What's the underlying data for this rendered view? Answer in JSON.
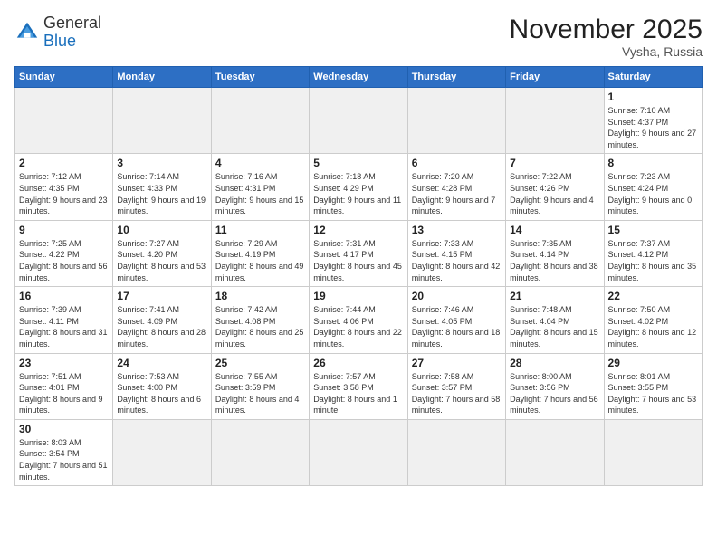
{
  "logo": {
    "text_general": "General",
    "text_blue": "Blue"
  },
  "title": {
    "month_year": "November 2025",
    "location": "Vysha, Russia"
  },
  "weekdays": [
    "Sunday",
    "Monday",
    "Tuesday",
    "Wednesday",
    "Thursday",
    "Friday",
    "Saturday"
  ],
  "weeks": [
    [
      {
        "day": "",
        "empty": true
      },
      {
        "day": "",
        "empty": true
      },
      {
        "day": "",
        "empty": true
      },
      {
        "day": "",
        "empty": true
      },
      {
        "day": "",
        "empty": true
      },
      {
        "day": "",
        "empty": true
      },
      {
        "day": "1",
        "sunrise": "7:10 AM",
        "sunset": "4:37 PM",
        "daylight": "9 hours and 27 minutes."
      }
    ],
    [
      {
        "day": "2",
        "sunrise": "7:12 AM",
        "sunset": "4:35 PM",
        "daylight": "9 hours and 23 minutes."
      },
      {
        "day": "3",
        "sunrise": "7:14 AM",
        "sunset": "4:33 PM",
        "daylight": "9 hours and 19 minutes."
      },
      {
        "day": "4",
        "sunrise": "7:16 AM",
        "sunset": "4:31 PM",
        "daylight": "9 hours and 15 minutes."
      },
      {
        "day": "5",
        "sunrise": "7:18 AM",
        "sunset": "4:29 PM",
        "daylight": "9 hours and 11 minutes."
      },
      {
        "day": "6",
        "sunrise": "7:20 AM",
        "sunset": "4:28 PM",
        "daylight": "9 hours and 7 minutes."
      },
      {
        "day": "7",
        "sunrise": "7:22 AM",
        "sunset": "4:26 PM",
        "daylight": "9 hours and 4 minutes."
      },
      {
        "day": "8",
        "sunrise": "7:23 AM",
        "sunset": "4:24 PM",
        "daylight": "9 hours and 0 minutes."
      }
    ],
    [
      {
        "day": "9",
        "sunrise": "7:25 AM",
        "sunset": "4:22 PM",
        "daylight": "8 hours and 56 minutes."
      },
      {
        "day": "10",
        "sunrise": "7:27 AM",
        "sunset": "4:20 PM",
        "daylight": "8 hours and 53 minutes."
      },
      {
        "day": "11",
        "sunrise": "7:29 AM",
        "sunset": "4:19 PM",
        "daylight": "8 hours and 49 minutes."
      },
      {
        "day": "12",
        "sunrise": "7:31 AM",
        "sunset": "4:17 PM",
        "daylight": "8 hours and 45 minutes."
      },
      {
        "day": "13",
        "sunrise": "7:33 AM",
        "sunset": "4:15 PM",
        "daylight": "8 hours and 42 minutes."
      },
      {
        "day": "14",
        "sunrise": "7:35 AM",
        "sunset": "4:14 PM",
        "daylight": "8 hours and 38 minutes."
      },
      {
        "day": "15",
        "sunrise": "7:37 AM",
        "sunset": "4:12 PM",
        "daylight": "8 hours and 35 minutes."
      }
    ],
    [
      {
        "day": "16",
        "sunrise": "7:39 AM",
        "sunset": "4:11 PM",
        "daylight": "8 hours and 31 minutes."
      },
      {
        "day": "17",
        "sunrise": "7:41 AM",
        "sunset": "4:09 PM",
        "daylight": "8 hours and 28 minutes."
      },
      {
        "day": "18",
        "sunrise": "7:42 AM",
        "sunset": "4:08 PM",
        "daylight": "8 hours and 25 minutes."
      },
      {
        "day": "19",
        "sunrise": "7:44 AM",
        "sunset": "4:06 PM",
        "daylight": "8 hours and 22 minutes."
      },
      {
        "day": "20",
        "sunrise": "7:46 AM",
        "sunset": "4:05 PM",
        "daylight": "8 hours and 18 minutes."
      },
      {
        "day": "21",
        "sunrise": "7:48 AM",
        "sunset": "4:04 PM",
        "daylight": "8 hours and 15 minutes."
      },
      {
        "day": "22",
        "sunrise": "7:50 AM",
        "sunset": "4:02 PM",
        "daylight": "8 hours and 12 minutes."
      }
    ],
    [
      {
        "day": "23",
        "sunrise": "7:51 AM",
        "sunset": "4:01 PM",
        "daylight": "8 hours and 9 minutes."
      },
      {
        "day": "24",
        "sunrise": "7:53 AM",
        "sunset": "4:00 PM",
        "daylight": "8 hours and 6 minutes."
      },
      {
        "day": "25",
        "sunrise": "7:55 AM",
        "sunset": "3:59 PM",
        "daylight": "8 hours and 4 minutes."
      },
      {
        "day": "26",
        "sunrise": "7:57 AM",
        "sunset": "3:58 PM",
        "daylight": "8 hours and 1 minute."
      },
      {
        "day": "27",
        "sunrise": "7:58 AM",
        "sunset": "3:57 PM",
        "daylight": "7 hours and 58 minutes."
      },
      {
        "day": "28",
        "sunrise": "8:00 AM",
        "sunset": "3:56 PM",
        "daylight": "7 hours and 56 minutes."
      },
      {
        "day": "29",
        "sunrise": "8:01 AM",
        "sunset": "3:55 PM",
        "daylight": "7 hours and 53 minutes."
      }
    ],
    [
      {
        "day": "30",
        "sunrise": "8:03 AM",
        "sunset": "3:54 PM",
        "daylight": "7 hours and 51 minutes."
      },
      {
        "day": "",
        "empty": true
      },
      {
        "day": "",
        "empty": true
      },
      {
        "day": "",
        "empty": true
      },
      {
        "day": "",
        "empty": true
      },
      {
        "day": "",
        "empty": true
      },
      {
        "day": "",
        "empty": true
      }
    ]
  ]
}
